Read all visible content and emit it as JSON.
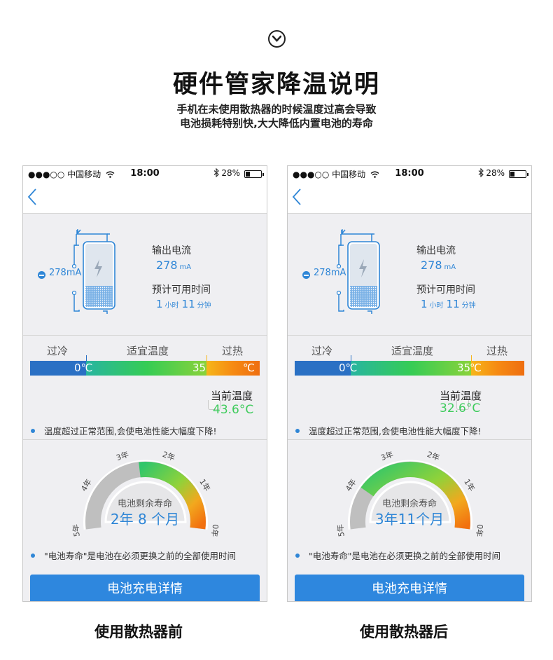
{
  "header": {
    "title": "硬件管家降温说明",
    "subtitle_line1": "手机在未使用散热器的时候温度过高会导致",
    "subtitle_line2": "电池损耗特别快,大大降低内置电池的寿命"
  },
  "status_bar": {
    "signal": "●●●○○ 中国移动",
    "time": "18:00",
    "battery_pct": "28%"
  },
  "colors": {
    "accent": "#2f86d6",
    "cold": "#2a70c4",
    "good": "#35cc55",
    "hot": "#f68a13",
    "current_temp": "#3ecb5c"
  },
  "panels": [
    {
      "caption": "使用散热器前",
      "current_ma": "278mA",
      "output_current_label": "输出电流",
      "output_current_value": "278",
      "output_current_unit": "mA",
      "est_time_label": "预计可用时间",
      "est_hours": "1",
      "hours_unit": "小时",
      "est_minutes": "11",
      "minutes_unit": "分钟",
      "zone_cold": "过冷",
      "zone_ok": "适宜温度",
      "zone_hot": "过热",
      "bar_label_0": "0℃",
      "bar_label_35": "35",
      "bar_label_c": "℃",
      "current_temp_label": "当前温度",
      "current_temp_value": "43.6°C",
      "current_temp_c": 43.6,
      "temp_note": "温度超过正常范围,会使电池性能大幅度下降!",
      "life_title": "电池剩余寿命",
      "life_value": "2年 8 个月",
      "life_years": 2.67,
      "gauge_ticks": [
        "5年",
        "4年",
        "3年",
        "2年",
        "1年",
        "0年"
      ],
      "life_note": "\"电池寿命\"是电池在必须更换之前的全部使用时间",
      "button_label": "电池充电详情"
    },
    {
      "caption": "使用散热器后",
      "current_ma": "278mA",
      "output_current_label": "输出电流",
      "output_current_value": "278",
      "output_current_unit": "mA",
      "est_time_label": "预计可用时间",
      "est_hours": "1",
      "hours_unit": "小时",
      "est_minutes": "11",
      "minutes_unit": "分钟",
      "zone_cold": "过冷",
      "zone_ok": "适宜温度",
      "zone_hot": "过热",
      "bar_label_0": "0℃",
      "bar_label_35": "35",
      "bar_label_c": "℃",
      "current_temp_label": "当前温度",
      "current_temp_value": "32.6°C",
      "current_temp_c": 32.6,
      "temp_note": "温度超过正常范围,会使电池性能大幅度下降!",
      "life_title": "电池剩余寿命",
      "life_value": "3年11个月",
      "life_years": 3.92,
      "gauge_ticks": [
        "5年",
        "4年",
        "3年",
        "2年",
        "1年",
        "0年"
      ],
      "life_note": "\"电池寿命\"是电池在必须更换之前的全部使用时间",
      "button_label": "电池充电详情"
    }
  ]
}
